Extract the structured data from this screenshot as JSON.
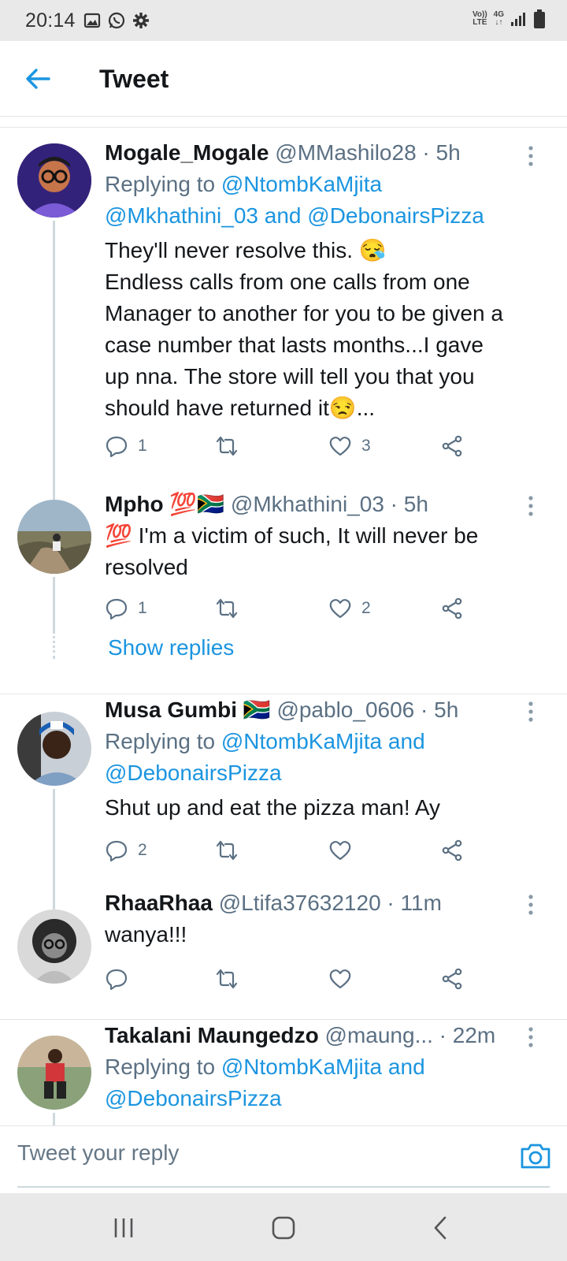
{
  "status_bar": {
    "time": "20:14",
    "left_icons": [
      "image-icon",
      "whatsapp-icon",
      "gear-icon"
    ],
    "volte": "Vo))\nLTE",
    "network": "4G"
  },
  "header": {
    "title": "Tweet"
  },
  "tweets": [
    {
      "name": "Mogale_Mogale",
      "handle": "@MMashilo28 · 5h",
      "replying_prefix": "Replying to ",
      "replying_line1": "@NtombKaMjita",
      "replying_line2a": "@Mkhathini_03",
      "replying_and": " and ",
      "replying_line2b": "@DebonairsPizza",
      "text_lines": [
        "They'll never resolve this. 😪",
        "Endless calls from one calls from one",
        "Manager  to another for you to be given a",
        "case number that lasts months...I gave",
        "up nna. The store will tell you that you",
        "should have returned it😒..."
      ],
      "replies": "1",
      "retweets": "",
      "likes": "3"
    },
    {
      "name": "Mpho 💯🇿🇦",
      "handle": "@Mkhathini_03 · 5h",
      "text_lines": [
        "💯 I'm a victim of such, It will never be",
        "resolved"
      ],
      "replies": "1",
      "retweets": "",
      "likes": "2",
      "show_replies": "Show replies"
    },
    {
      "name": "Musa Gumbi 🇿🇦",
      "handle": "@pablo_0606 · 5h",
      "replying_prefix": "Replying to ",
      "replying_line1": "@NtombKaMjita",
      "replying_and": " and",
      "replying_line2": "@DebonairsPizza",
      "text_lines": [
        "Shut up and eat the pizza man! Ay"
      ],
      "replies": "2",
      "retweets": "",
      "likes": ""
    },
    {
      "name": "RhaaRhaa",
      "handle": "@Ltifa37632120 · 11m",
      "text_lines": [
        "wanya!!!"
      ],
      "replies": "",
      "retweets": "",
      "likes": ""
    },
    {
      "name": "Takalani Maungedzo",
      "handle": "@maung...",
      "time": " · 22m",
      "replying_prefix": "Replying to ",
      "replying_line1": "@NtombKaMjita",
      "replying_and": " and",
      "replying_line2": "@DebonairsPizza"
    }
  ],
  "reply_bar": {
    "placeholder": "Tweet your reply"
  },
  "colors": {
    "accent": "#1b95e0",
    "secondary_text": "#5b7083",
    "divider": "#e1e4e8"
  }
}
